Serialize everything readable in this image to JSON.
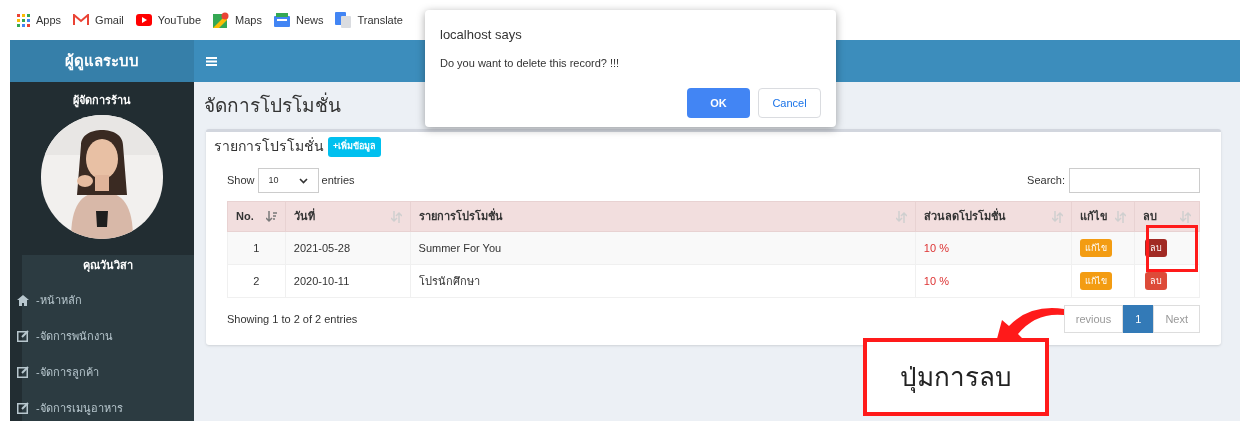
{
  "bookmarks": [
    {
      "kind": "apps",
      "label": "Apps"
    },
    {
      "kind": "gmail",
      "label": "Gmail"
    },
    {
      "kind": "youtube",
      "label": "YouTube"
    },
    {
      "kind": "maps",
      "label": "Maps"
    },
    {
      "kind": "news",
      "label": "News"
    },
    {
      "kind": "translate",
      "label": "Translate"
    }
  ],
  "sidebar": {
    "brand": "ผู้ดูแลระบบ",
    "role": "ผู้จัดการร้าน",
    "user_name": "คุณวันวิสา",
    "items": [
      {
        "kind": "home",
        "label": "-หน้าหลัก"
      },
      {
        "kind": "edit",
        "label": "-จัดการพนักงาน"
      },
      {
        "kind": "edit",
        "label": "-จัดการลูกค้า"
      },
      {
        "kind": "edit",
        "label": "-จัดการเมนูอาหาร"
      }
    ]
  },
  "page_title": "จัดการโปรโมชั่น",
  "card": {
    "title": "รายการโปรโมชั่น",
    "add_button": "+เพิ่มข้อมูล",
    "show_label": "Show",
    "page_size": "10",
    "entries_label": "entries",
    "search_label": "Search:",
    "columns": [
      {
        "label": "No.",
        "sorted": true
      },
      {
        "label": "วันที่",
        "sorted": false
      },
      {
        "label": "รายการโปรโมชั่น",
        "sorted": false
      },
      {
        "label": "ส่วนลดโปรโมชั่น",
        "sorted": false
      },
      {
        "label": "แก้ไข",
        "sorted": false
      },
      {
        "label": "ลบ",
        "sorted": false
      }
    ],
    "rows": [
      {
        "no": "1",
        "date": "2021-05-28",
        "name": "Summer For You",
        "discount": "10 %",
        "edit": "แก้ไข",
        "delete": "ลบ",
        "pressed": true
      },
      {
        "no": "2",
        "date": "2020-10-11",
        "name": "โปรนักศึกษา",
        "discount": "10 %",
        "edit": "แก้ไข",
        "delete": "ลบ",
        "pressed": false
      }
    ],
    "info": "Showing 1 to 2 of 2 entries",
    "pagination": [
      {
        "label": "revious",
        "selected": false
      },
      {
        "label": "1",
        "selected": true
      },
      {
        "label": "Next",
        "selected": false
      }
    ]
  },
  "dialog": {
    "title": "localhost says",
    "message": "Do you want to delete this record? !!!",
    "ok": "OK",
    "cancel": "Cancel"
  },
  "annotation": {
    "label": "ปุ่มการลบ"
  }
}
